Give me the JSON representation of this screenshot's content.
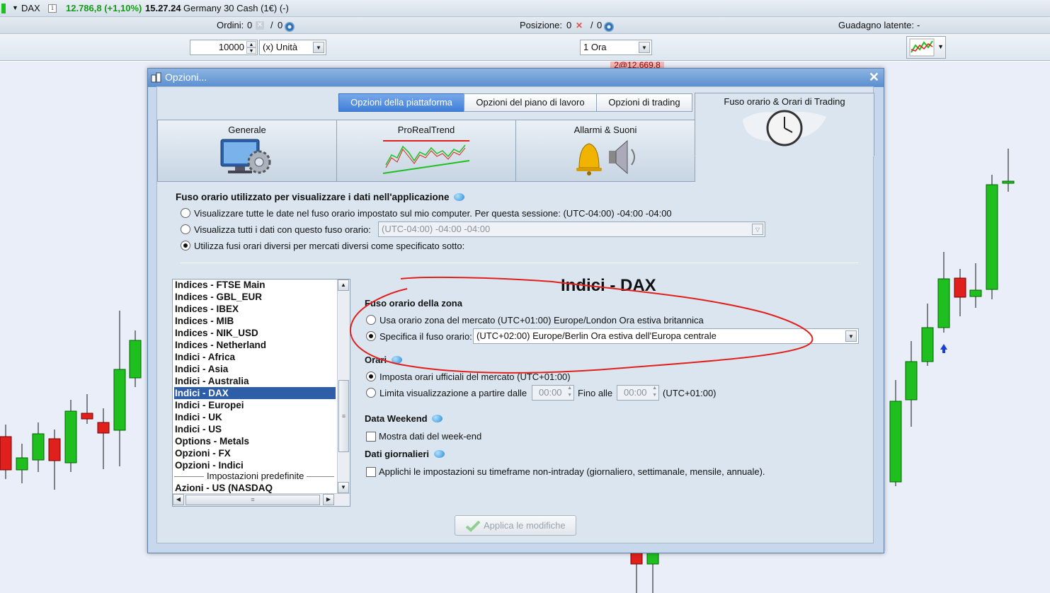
{
  "topbar": {
    "symbol": "DAX",
    "quote": "12.786,8 (+1,10%)",
    "time": "15.27.24",
    "instrument": "Germany 30 Cash (1€) (-)"
  },
  "orders_bar": {
    "ordini_label": "Ordini:",
    "ordini_a": "0",
    "ordini_sep": "/",
    "ordini_b": "0",
    "posizione_label": "Posizione:",
    "posizione_a": "0",
    "posizione_sep": "/",
    "posizione_b": "0",
    "guadagno_label": "Guadagno latente:",
    "guadagno_value": "-"
  },
  "trade_bar": {
    "quantity": "10000",
    "unit": "(x) Unità",
    "timeframe": "1 Ora",
    "price_tag": "2@12.669,8"
  },
  "dialog": {
    "title": "Opzioni...",
    "top_tabs": [
      "Opzioni della piattaforma",
      "Opzioni del piano di lavoro",
      "Opzioni di trading"
    ],
    "category_tabs": [
      "Generale",
      "ProRealTrend",
      "Allarmi & Suoni",
      "Fuso orario & Orari di Trading"
    ],
    "tz_section_title": "Fuso orario utilizzato per visualizzare i dati nell'applicazione",
    "tz_opt1": "Visualizzare tutte le date nel fuso orario impostato sul mio computer. Per questa sessione: (UTC-04:00) -04:00 -04:00",
    "tz_opt2": "Visualizza tutti i dati con questo fuso orario:",
    "tz_opt2_value": "(UTC-04:00) -04:00 -04:00",
    "tz_opt3": "Utilizza fusi orari diversi per mercati diversi come specificato sotto:",
    "list_items": [
      "Indices - FTSE Main",
      "Indices - GBL_EUR",
      "Indices - IBEX",
      "Indices - MIB",
      "Indices - NIK_USD",
      "Indices - Netherland",
      "Indici - Africa",
      "Indici - Asia",
      "Indici - Australia",
      "Indici - DAX",
      "Indici - Europei",
      "Indici - UK",
      "Indici - US",
      "Options - Metals",
      "Opzioni - FX",
      "Opzioni - Indici"
    ],
    "list_separator": "Impostazioni predefinite",
    "list_last": "Azioni - US (NASDAQ",
    "detail_title": "Indici - DAX",
    "zone_heading": "Fuso orario della zona",
    "zone_opt1": "Usa orario zona del mercato (UTC+01:00) Europe/London Ora estiva britannica",
    "zone_opt2": "Specifica il fuso orario:",
    "zone_opt2_value": "(UTC+02:00) Europe/Berlin Ora estiva dell'Europa centrale",
    "orari_heading": "Orari",
    "orari_opt1": "Imposta orari ufficiali del mercato  (UTC+01:00)",
    "orari_opt2": "Limita visualizzazione  a partire dalle",
    "orari_from": "00:00",
    "orari_to_label": "Fino alle",
    "orari_to": "00:00",
    "orari_tz": "(UTC+01:00)",
    "weekend_heading": "Data Weekend",
    "weekend_check": "Mostra dati del week-end",
    "daily_heading": "Dati giornalieri",
    "daily_check": "Applichi le impostazioni su timeframe non-intraday (giornaliero, settimanale, mensile, annuale).",
    "apply_button": "Applica le modifiche"
  },
  "colors": {
    "up_candle": "#1fbf1f",
    "down_candle": "#e0201c",
    "annotation": "#e0201c",
    "selected_item": "#2e5ea8",
    "active_tab": "#4f8be0"
  }
}
